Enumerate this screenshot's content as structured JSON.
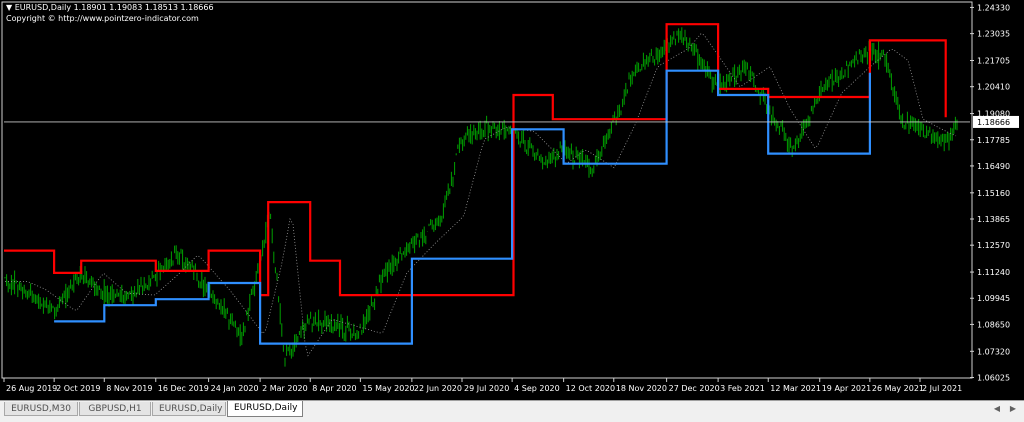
{
  "header": {
    "symbol_line": "EURUSD,Daily  1.18901 1.19083 1.18513 1.18666",
    "copyright": "Copyright © http://www.pointzero-indicator.com"
  },
  "tabs": [
    {
      "label": "EURUSD,M30",
      "active": false
    },
    {
      "label": "GBPUSD,H1",
      "active": false
    },
    {
      "label": "EURUSD,Daily",
      "active": false
    },
    {
      "label": "EURUSD,Daily",
      "active": true
    }
  ],
  "colors": {
    "background": "#000000",
    "bull_candle": "#00a000",
    "upper_band": "#ff0000",
    "lower_band": "#2f8fff",
    "midline": "#9a9a9a",
    "axis_text": "#ffffff"
  },
  "chart_data": {
    "type": "candlestick",
    "symbol": "EURUSD",
    "timeframe": "Daily",
    "ylim": [
      1.06,
      1.245
    ],
    "current_price": 1.18666,
    "y_ticks": [
      "1.24330",
      "1.23035",
      "1.21705",
      "1.20410",
      "1.19080",
      "1.17785",
      "1.16490",
      "1.15160",
      "1.13865",
      "1.12570",
      "1.11240",
      "1.09945",
      "1.08650",
      "1.07320",
      "1.06025"
    ],
    "x_ticks": [
      "26 Aug 2019",
      "2 Oct 2019",
      "8 Nov 2019",
      "16 Dec 2019",
      "24 Jan 2020",
      "2 Mar 2020",
      "8 Apr 2020",
      "15 May 2020",
      "22 Jun 2020",
      "29 Jul 2020",
      "4 Sep 2020",
      "12 Oct 2020",
      "18 Nov 2020",
      "27 Dec 2020",
      "3 Feb 2021",
      "12 Mar 2021",
      "19 Apr 2021",
      "26 May 2021",
      "2 Jul 2021"
    ],
    "price_path": [
      {
        "x": "26 Aug 2019",
        "y": 1.108
      },
      {
        "x": "9 Sep 2019",
        "y": 1.104
      },
      {
        "x": "2 Oct 2019",
        "y": 1.093
      },
      {
        "x": "22 Oct 2019",
        "y": 1.112
      },
      {
        "x": "8 Nov 2019",
        "y": 1.102
      },
      {
        "x": "29 Nov 2019",
        "y": 1.101
      },
      {
        "x": "16 Dec 2019",
        "y": 1.111
      },
      {
        "x": "31 Dec 2019",
        "y": 1.121
      },
      {
        "x": "24 Jan 2020",
        "y": 1.103
      },
      {
        "x": "18 Feb 2020",
        "y": 1.081
      },
      {
        "x": "2 Mar 2020",
        "y": 1.117
      },
      {
        "x": "9 Mar 2020",
        "y": 1.143
      },
      {
        "x": "20 Mar 2020",
        "y": 1.07
      },
      {
        "x": "8 Apr 2020",
        "y": 1.089
      },
      {
        "x": "15 May 2020",
        "y": 1.082
      },
      {
        "x": "2 Jun 2020",
        "y": 1.112
      },
      {
        "x": "22 Jun 2020",
        "y": 1.126
      },
      {
        "x": "14 Jul 2020",
        "y": 1.14
      },
      {
        "x": "29 Jul 2020",
        "y": 1.178
      },
      {
        "x": "14 Aug 2020",
        "y": 1.184
      },
      {
        "x": "4 Sep 2020",
        "y": 1.182
      },
      {
        "x": "28 Sep 2020",
        "y": 1.166
      },
      {
        "x": "12 Oct 2020",
        "y": 1.173
      },
      {
        "x": "2 Nov 2020",
        "y": 1.164
      },
      {
        "x": "18 Nov 2020",
        "y": 1.186
      },
      {
        "x": "4 Dec 2020",
        "y": 1.214
      },
      {
        "x": "27 Dec 2020",
        "y": 1.223
      },
      {
        "x": "6 Jan 2021",
        "y": 1.231
      },
      {
        "x": "3 Feb 2021",
        "y": 1.204
      },
      {
        "x": "25 Feb 2021",
        "y": 1.214
      },
      {
        "x": "12 Mar 2021",
        "y": 1.193
      },
      {
        "x": "31 Mar 2021",
        "y": 1.173
      },
      {
        "x": "19 Apr 2021",
        "y": 1.201
      },
      {
        "x": "10 May 2021",
        "y": 1.214
      },
      {
        "x": "26 May 2021",
        "y": 1.223
      },
      {
        "x": "7 Jun 2021",
        "y": 1.217
      },
      {
        "x": "18 Jun 2021",
        "y": 1.188
      },
      {
        "x": "2 Jul 2021",
        "y": 1.183
      },
      {
        "x": "21 Jul 2021",
        "y": 1.177
      },
      {
        "x": "30 Jul 2021",
        "y": 1.187
      }
    ],
    "upper_band": [
      {
        "x": "26 Aug 2019",
        "y": 1.123
      },
      {
        "x": "2 Oct 2019",
        "y": 1.112
      },
      {
        "x": "22 Oct 2019",
        "y": 1.118
      },
      {
        "x": "16 Dec 2019",
        "y": 1.113
      },
      {
        "x": "24 Jan 2020",
        "y": 1.123
      },
      {
        "x": "2 Mar 2020",
        "y": 1.101
      },
      {
        "x": "8 Mar 2020",
        "y": 1.147
      },
      {
        "x": "8 Apr 2020",
        "y": 1.118
      },
      {
        "x": "30 Apr 2020",
        "y": 1.101
      },
      {
        "x": "2 Jun 2020",
        "y": 1.101
      },
      {
        "x": "5 Sep 2020",
        "y": 1.2
      },
      {
        "x": "4 Oct 2020",
        "y": 1.188
      },
      {
        "x": "27 Dec 2020",
        "y": 1.235
      },
      {
        "x": "3 Feb 2021",
        "y": 1.203
      },
      {
        "x": "12 Mar 2021",
        "y": 1.199
      },
      {
        "x": "26 May 2021",
        "y": 1.227
      },
      {
        "x": "21 Jul 2021",
        "y": 1.189
      }
    ],
    "lower_band": [
      {
        "x": "2 Oct 2019",
        "y": 1.088
      },
      {
        "x": "8 Nov 2019",
        "y": 1.096
      },
      {
        "x": "16 Dec 2019",
        "y": 1.099
      },
      {
        "x": "24 Jan 2020",
        "y": 1.107
      },
      {
        "x": "2 Mar 2020",
        "y": 1.077
      },
      {
        "x": "15 May 2020",
        "y": 1.077
      },
      {
        "x": "22 Jun 2020",
        "y": 1.119
      },
      {
        "x": "4 Sep 2020",
        "y": 1.183
      },
      {
        "x": "12 Oct 2020",
        "y": 1.166
      },
      {
        "x": "27 Dec 2020",
        "y": 1.212
      },
      {
        "x": "3 Feb 2021",
        "y": 1.2
      },
      {
        "x": "12 Mar 2021",
        "y": 1.171
      },
      {
        "x": "26 May 2021",
        "y": 1.211
      }
    ]
  }
}
